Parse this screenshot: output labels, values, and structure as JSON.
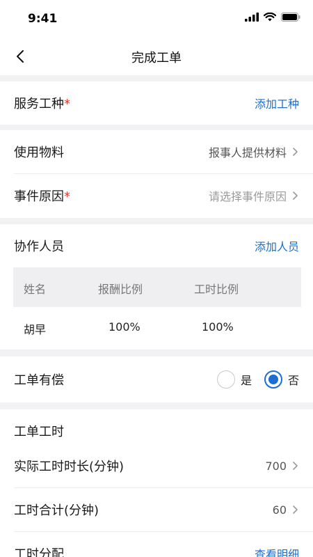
{
  "status_bar": {
    "time": "9:41"
  },
  "nav": {
    "title": "完成工单"
  },
  "service_type": {
    "label": "服务工种",
    "required_mark": "*",
    "action": "添加工种"
  },
  "materials": {
    "label": "使用物料",
    "value": "报事人提供材料"
  },
  "event_reason": {
    "label": "事件原因",
    "required_mark": "*",
    "placeholder": "请选择事件原因"
  },
  "collaborators": {
    "label": "协作人员",
    "action": "添加人员",
    "columns": [
      "姓名",
      "报酬比例",
      "工时比例"
    ],
    "rows": [
      {
        "name": "胡早",
        "pay_ratio": "100%",
        "hour_ratio": "100%"
      }
    ]
  },
  "paid": {
    "label": "工单有偿",
    "options": [
      "是",
      "否"
    ],
    "selected": "否"
  },
  "work_hours": {
    "title": "工单工时",
    "actual": {
      "label": "实际工时时长(分钟)",
      "value": "700"
    },
    "total": {
      "label": "工时合计(分钟)",
      "value": "60"
    },
    "allocation": {
      "label": "工时分配",
      "action": "查看明细"
    }
  }
}
